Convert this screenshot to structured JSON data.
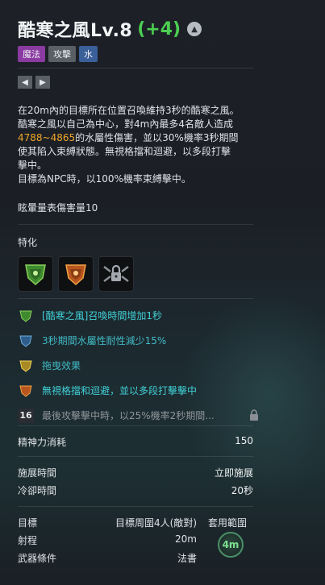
{
  "skill": {
    "name": "酷寒之風Lv.8",
    "plus": "(+4)",
    "tags": [
      "魔法",
      "攻擊",
      "水"
    ]
  },
  "description": {
    "line1": "在20m內的目標所在位置召喚維持3秒的酷寒之風。",
    "line2": "酷寒之風以自己為中心，對4m內最多4名敵人造成",
    "damage": "4788~4865",
    "line3_rest": "的水屬性傷害，並以30%機率3秒期間",
    "line4": "使其陷入束縛狀態。無視格擋和迴避，以多段打擊",
    "line5": "擊中。",
    "line6": "目標為NPC時，以100%機率束縛擊中。"
  },
  "stun_text": "眩暈量表傷害量10",
  "specialization_title": "特化",
  "spec_effects": [
    {
      "text": "[酷寒之風]召喚時間增加1秒",
      "color": "#41d0d6",
      "icon": "green-shield-icon"
    },
    {
      "text": "3秒期間水屬性耐性減少15%",
      "color": "#41b9c4",
      "icon": "blue-shield-icon"
    },
    {
      "text": "拖曳效果",
      "color": "#41b9c4",
      "icon": "yellow-shield-icon"
    },
    {
      "text": "無視格擋和迴避，並以多段打擊擊中",
      "color": "#41d0d6",
      "icon": "orange-shield-icon"
    },
    {
      "text": "最後攻擊擊中時，以25%機率2秒期間...",
      "color": "#8f949a",
      "icon": "level-badge",
      "badge": "16"
    }
  ],
  "stats": {
    "mp_label": "精神力消耗",
    "mp_value": "150",
    "cast_label": "施展時間",
    "cast_value": "立即施展",
    "cooldown_label": "冷卻時間",
    "cooldown_value": "20秒",
    "target_label": "目標",
    "target_value": "目標周圍4人(敵對)",
    "range_label": "射程",
    "range_value": "20m",
    "weapon_label": "武器條件",
    "weapon_value": "法書",
    "area_label": "套用範圍",
    "area_value": "4m"
  },
  "colors": {
    "accent_green": "#4ccf52",
    "tag_magic": "#8b3aa2",
    "tag_attack": "#5a5f66",
    "tag_water": "#3a5f99",
    "damage_orange": "#f0a62a"
  }
}
